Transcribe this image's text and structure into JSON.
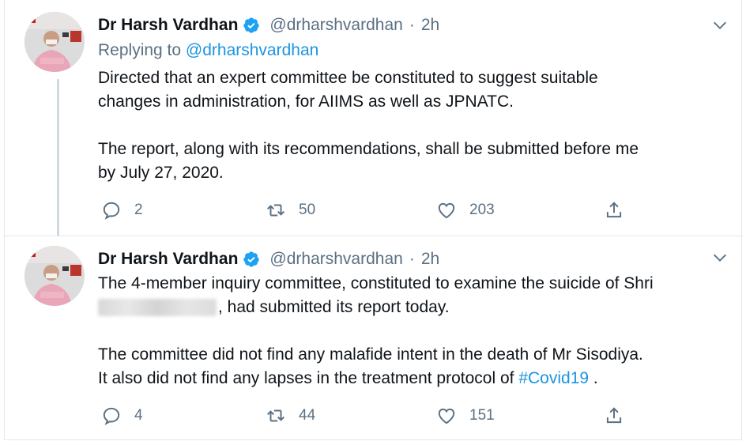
{
  "tweets": [
    {
      "author": "Dr Harsh Vardhan",
      "handle": "@drharshvardhan",
      "separator": "·",
      "time": "2h",
      "replying_prefix": "Replying to",
      "replying_to": "@drharshvardhan",
      "lines": [
        "Directed that an expert committee be constituted to suggest suitable",
        "changes in administration, for AIIMS as well as JPNATC.",
        "The report, along with its recommendations, shall be submitted before me",
        "by July 27, 2020."
      ],
      "replies": "2",
      "retweets": "50",
      "likes": "203"
    },
    {
      "author": "Dr Harsh Vardhan",
      "handle": "@drharshvardhan",
      "separator": "·",
      "time": "2h",
      "lines": [
        "The 4-member inquiry committee, constituted to examine the suicide of Shri",
        ", had submitted its report today.",
        "The committee did not find any malafide intent in the death of Mr Sisodiya.",
        "It also did not find any lapses in the treatment protocol of",
        " ."
      ],
      "hashtag": "#Covid19",
      "replies": "4",
      "retweets": "44",
      "likes": "151"
    }
  ],
  "colors": {
    "link": "#1b95e0",
    "muted": "#5b7083",
    "verified": "#1da1f2",
    "thread_line": "#cfd9de"
  },
  "icons": [
    "verified-badge-icon",
    "chevron-down-icon",
    "reply-icon",
    "retweet-icon",
    "like-icon",
    "share-icon"
  ]
}
